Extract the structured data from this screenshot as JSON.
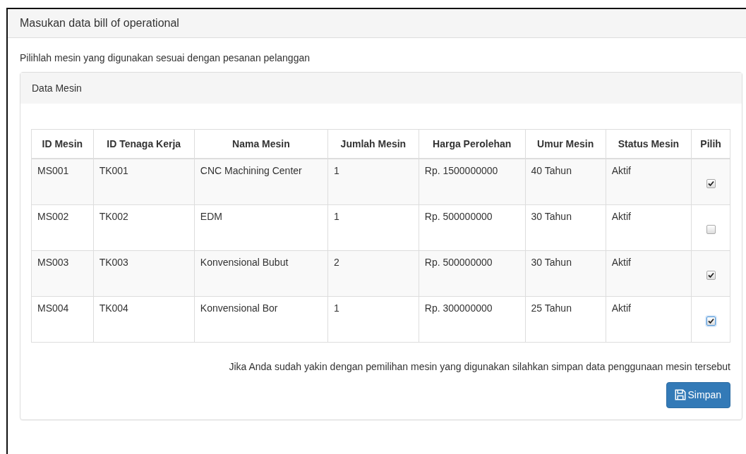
{
  "panel": {
    "title": "Masukan data bill of operational",
    "instruction": "Pilihlah mesin yang digunakan sesuai dengan pesanan pelanggan"
  },
  "data_panel": {
    "title": "Data Mesin"
  },
  "table": {
    "columns": [
      "ID Mesin",
      "ID Tenaga Kerja",
      "Nama Mesin",
      "Jumlah Mesin",
      "Harga Perolehan",
      "Umur Mesin",
      "Status Mesin",
      "Pilih"
    ],
    "rows": [
      {
        "cells": [
          "MS001",
          "TK001",
          "CNC Machining Center",
          "1",
          "Rp. 1500000000",
          "40 Tahun",
          "Aktif"
        ],
        "checked": true
      },
      {
        "cells": [
          "MS002",
          "TK002",
          "EDM",
          "1",
          "Rp. 500000000",
          "30 Tahun",
          "Aktif"
        ],
        "checked": false
      },
      {
        "cells": [
          "MS003",
          "TK003",
          "Konvensional Bubut",
          "2",
          "Rp. 500000000",
          "30 Tahun",
          "Aktif"
        ],
        "checked": true
      },
      {
        "cells": [
          "MS004",
          "TK004",
          "Konvensional Bor",
          "1",
          "Rp. 300000000",
          "25 Tahun",
          "Aktif"
        ],
        "checked": true
      }
    ]
  },
  "footer": {
    "note": "Jika Anda sudah yakin dengan pemilihan mesin yang digunakan silahkan simpan data penggunaan mesin tersebut",
    "button": "Simpan"
  }
}
